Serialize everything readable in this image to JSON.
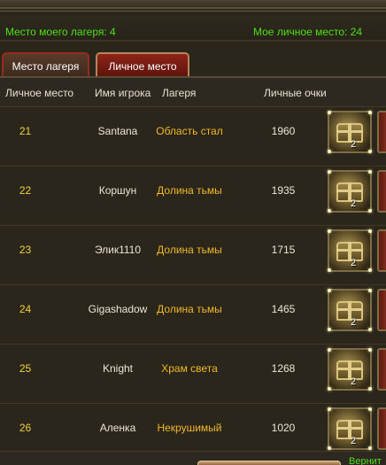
{
  "info": {
    "camp_place_label": "Место моего лагеря: 4",
    "personal_place_label": "Мое личное место: 24"
  },
  "tabs": [
    {
      "label": "Место лагеря"
    },
    {
      "label": "Личное место"
    }
  ],
  "table": {
    "headers": [
      "Личное место",
      "Имя игрока",
      "Лагеря",
      "Личные очки"
    ],
    "rows": [
      {
        "rank": "21",
        "name": "Santana",
        "camp": "Область стал",
        "points": "1960",
        "reward_count": "2"
      },
      {
        "rank": "22",
        "name": "Коршун",
        "camp": "Долина тьмы",
        "points": "1935",
        "reward_count": "2"
      },
      {
        "rank": "23",
        "name": "Элик1110",
        "camp": "Долина тьмы",
        "points": "1715",
        "reward_count": "2"
      },
      {
        "rank": "24",
        "name": "Gigashadow",
        "camp": "Долина тьмы",
        "points": "1465",
        "reward_count": "2"
      },
      {
        "rank": "25",
        "name": "Knight",
        "camp": "Храм света",
        "points": "1268",
        "reward_count": "2"
      },
      {
        "rank": "26",
        "name": "Аленка",
        "camp": "Некрушимый",
        "points": "1020",
        "reward_count": "2"
      }
    ]
  },
  "footer": {
    "return_link": "Вернит"
  },
  "colors": {
    "accent_green": "#4ee017",
    "rank_yellow": "#f1d23e",
    "camp_gold": "#f1b829",
    "tab_red": "#8f2418"
  },
  "icons": {
    "reward": "treasure-chest-icon",
    "reward_secondary": "red-chest-icon"
  }
}
